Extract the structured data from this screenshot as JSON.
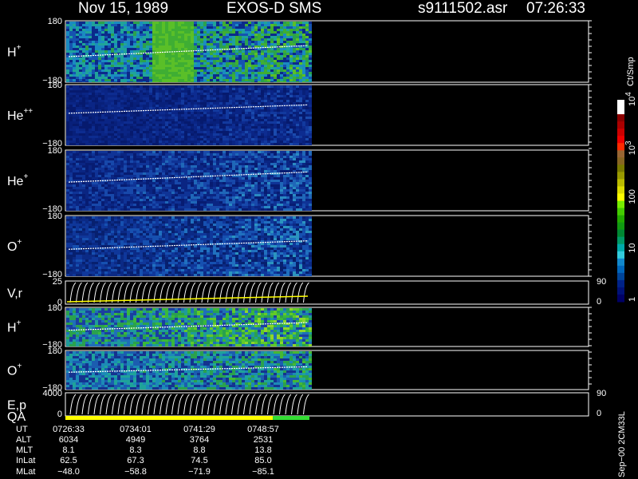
{
  "header": {
    "date": "Nov 15, 1989",
    "instrument": "EXOS-D SMS",
    "file": "s9111502.asr",
    "time": "07:26:33"
  },
  "chart_data": {
    "type": "heatmap",
    "time_range": [
      "0726:33",
      "0748:57"
    ],
    "panels": [
      {
        "id": "h1",
        "species": "H",
        "charge": "+",
        "ylim": [
          -180,
          180
        ],
        "ticks": [
          "180",
          "−180"
        ],
        "palette": "green",
        "line": [
          -30,
          35
        ]
      },
      {
        "id": "he2",
        "species": "He",
        "charge": "++",
        "ylim": [
          -180,
          180
        ],
        "ticks": [
          "180",
          "−180"
        ],
        "palette": "dark",
        "line": [
          10,
          60
        ]
      },
      {
        "id": "he1",
        "species": "He",
        "charge": "+",
        "ylim": [
          -180,
          180
        ],
        "ticks": [
          "180",
          "−180"
        ],
        "palette": "mid",
        "line": [
          -10,
          50
        ]
      },
      {
        "id": "o1",
        "species": "O",
        "charge": "+",
        "ylim": [
          -180,
          180
        ],
        "ticks": [
          "180",
          "−180"
        ],
        "palette": "oxy",
        "line": [
          -20,
          30
        ]
      },
      {
        "id": "vr",
        "species": "V,r",
        "charge": "",
        "ylim": [
          0,
          25
        ],
        "ticks": [
          "25",
          "0"
        ],
        "right_ticks": [
          "90",
          "0"
        ],
        "palette": "line"
      },
      {
        "id": "h2",
        "species": "H",
        "charge": "+",
        "ylim": [
          -180,
          180
        ],
        "ticks": [
          "180",
          "−180"
        ],
        "palette": "green2",
        "line": [
          -30,
          40
        ]
      },
      {
        "id": "o2",
        "species": "O",
        "charge": "+",
        "ylim": [
          -180,
          180
        ],
        "ticks": [
          "180",
          "−180"
        ],
        "palette": "green3",
        "line": [
          -20,
          30
        ]
      },
      {
        "id": "ep",
        "species": "E,p",
        "charge": "",
        "ylim": [
          0,
          4000
        ],
        "ticks": [
          "4000",
          "0"
        ],
        "right_ticks": [
          "90",
          "0"
        ],
        "palette": "line"
      }
    ],
    "qa": {
      "label": "QA",
      "segments": [
        {
          "from": 0,
          "to": 0.85,
          "color": "#ffff00"
        },
        {
          "from": 0.85,
          "to": 1,
          "color": "#33dd33"
        }
      ]
    },
    "colorbar": {
      "label": "Ct/Smp",
      "ticks": [
        {
          "label": "1",
          "exp": "",
          "value": 1
        },
        {
          "label": "10",
          "exp": "",
          "value": 10
        },
        {
          "label": "100",
          "exp": "",
          "value": 100
        },
        {
          "label": "10",
          "exp": "3",
          "value": 1000
        },
        {
          "label": "10",
          "exp": "4",
          "value": 10000
        }
      ],
      "colors": [
        "#ffffff",
        "#ffffff",
        "#8b0000",
        "#aa0000",
        "#cc0000",
        "#ee0000",
        "#ff2a00",
        "#996633",
        "#886622",
        "#7a7a00",
        "#999900",
        "#bbbb00",
        "#dddd00",
        "#ffff00",
        "#77ee00",
        "#44cc00",
        "#22aa00",
        "#119911",
        "#008833",
        "#009966",
        "#00aaaa",
        "#33ccdd",
        "#1188cc",
        "#0066bb",
        "#004499",
        "#002288",
        "#001177",
        "#000066"
      ]
    },
    "orbit": {
      "labels": [
        "UT",
        "ALT",
        "MLT",
        "InLat",
        "MLat"
      ],
      "columns": [
        [
          "0726:33",
          "6034",
          "8.1",
          "62.5",
          "−48.0"
        ],
        [
          "0734:01",
          "4949",
          "8.3",
          "67.3",
          "−58.8"
        ],
        [
          "0741:29",
          "3764",
          "8.8",
          "74.5",
          "−71.9"
        ],
        [
          "0748:57",
          "2531",
          "13.8",
          "85.0",
          "−85.1"
        ]
      ]
    },
    "footer": "Sep−00 2CM33L"
  }
}
